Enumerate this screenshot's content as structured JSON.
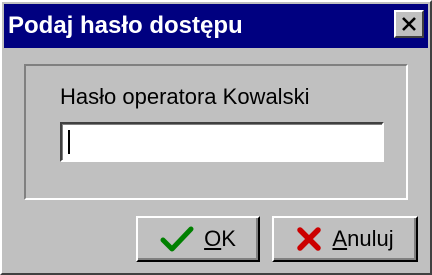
{
  "window": {
    "title": "Podaj hasło dostępu",
    "close_icon": "close-icon"
  },
  "form": {
    "label": "Hasło operatora Kowalski",
    "password_value": ""
  },
  "buttons": {
    "ok": {
      "accel": "O",
      "rest": "K",
      "icon": "check-icon",
      "icon_color": "#008000"
    },
    "cancel": {
      "accel": "A",
      "rest": "nuluj",
      "icon": "x-icon",
      "icon_color": "#cc0000"
    }
  },
  "colors": {
    "titlebar": "#000080",
    "face": "#c0c0c0"
  }
}
